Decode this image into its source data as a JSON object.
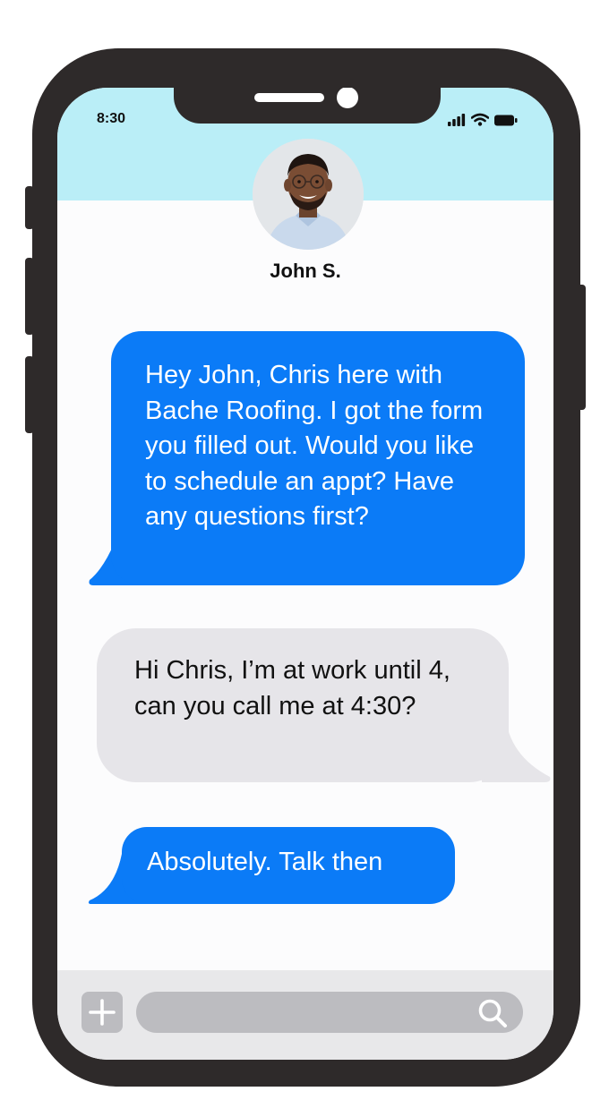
{
  "status_bar": {
    "time": "8:30",
    "icons": [
      "signal-bars-icon",
      "wifi-icon",
      "battery-icon"
    ]
  },
  "contact": {
    "name": "John S.",
    "avatar": "contact-avatar-photo"
  },
  "messages": [
    {
      "direction": "outgoing",
      "text": "Hey John, Chris here with Bache Roofing. I got the form you filled out. Would you like to schedule an appt? Have any questions first?"
    },
    {
      "direction": "incoming",
      "text": "Hi Chris, I’m at work until 4, can you call me at 4:30?"
    },
    {
      "direction": "outgoing",
      "text": "Absolutely. Talk then"
    }
  ],
  "composer": {
    "add_icon": "plus-icon",
    "search_icon": "search-icon"
  },
  "colors": {
    "header_background": "#baeef7",
    "outgoing_bubble": "#0b7bf7",
    "incoming_bubble": "#e6e5e9",
    "phone_frame": "#2e2a2a",
    "composer_controls": "#bcbcc0"
  }
}
